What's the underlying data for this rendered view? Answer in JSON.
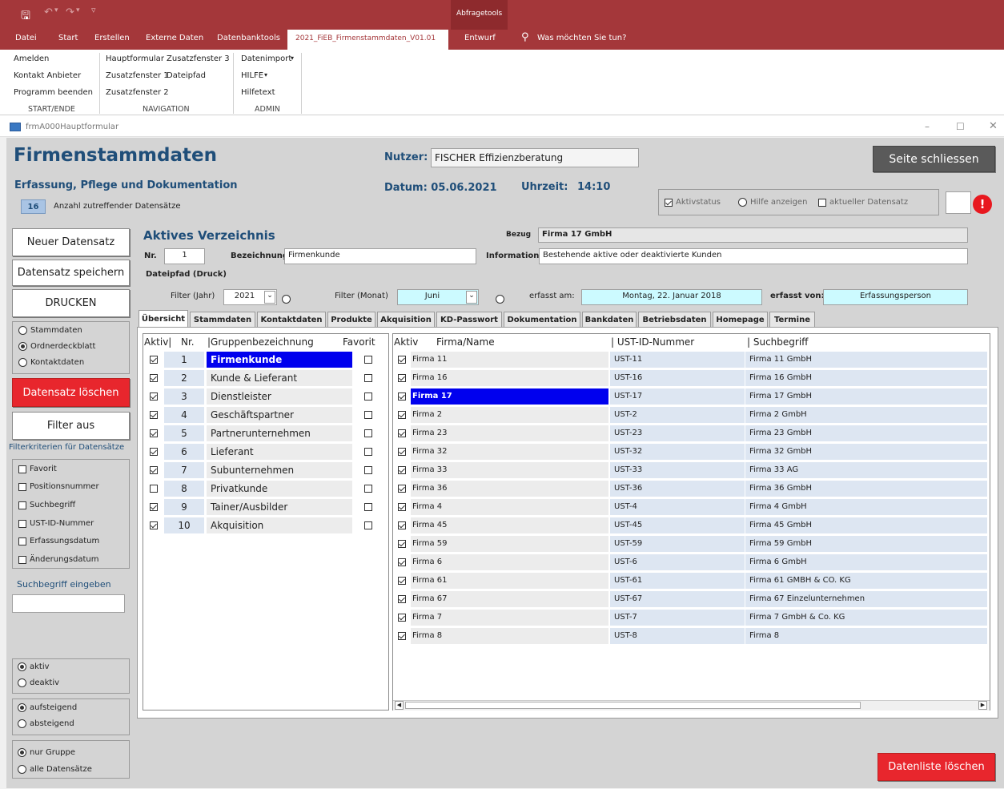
{
  "titlebar": {
    "context_group": "Abfragetools"
  },
  "menu": {
    "items": [
      "Datei",
      "Start",
      "Erstellen",
      "Externe Daten",
      "Datenbanktools",
      "2021_FiEB_Firmenstammdaten_V01.01",
      "Entwurf"
    ],
    "search": "Was möchten Sie tun?"
  },
  "ribbon": {
    "start_ende": {
      "items": [
        "Amelden",
        "Kontakt Anbieter",
        "Programm beenden"
      ],
      "label": "START/ENDE"
    },
    "navigation": {
      "items": [
        "Hauptformular",
        "Zusatzfenster 3",
        "Zusatzfenster 1",
        "Dateipfad",
        "Zusatzfenster 2"
      ],
      "label": "NAVIGATION"
    },
    "admin": {
      "items": [
        "Datenimport",
        "HILFE",
        "Hilfetext"
      ],
      "label": "ADMIN"
    }
  },
  "form": {
    "window_title": "frmA000Hauptformular",
    "title": "Firmenstammdaten",
    "subtitle": "Erfassung, Pflege und Dokumentation",
    "nutzer_label": "Nutzer:",
    "nutzer_value": "FISCHER Effizienzberatung",
    "datum": "Datum: 05.06.2021",
    "uhrzeit_label": "Uhrzeit:",
    "uhrzeit": "14:10",
    "close_button": "Seite schliessen",
    "count": "16",
    "count_label": "Anzahl zutreffender Datensätze",
    "aktivstatus": "Aktivstatus",
    "hilfe": "Hilfe anzeigen",
    "aktueller": "aktueller Datensatz",
    "warn": "!"
  },
  "left": {
    "neuer": "Neuer Datensatz",
    "speichern": "Datensatz speichern",
    "drucken": "DRUCKEN",
    "print_opts": [
      "Stammdaten",
      "Ordnerdeckblatt",
      "Kontaktdaten"
    ],
    "loeschen": "Datensatz löschen",
    "filter_aus": "Filter aus",
    "filter_title": "Filterkriterien für Datensätze",
    "filters": [
      "Favorit",
      "Positionsnummer",
      "Suchbegriff",
      "UST-ID-Nummer",
      "Erfassungsdatum",
      "Änderungsdatum"
    ],
    "search_label": "Suchbegriff eingeben",
    "status_opts": [
      "aktiv",
      "deaktiv"
    ],
    "sort_opts": [
      "aufsteigend",
      "absteigend"
    ],
    "scope_opts": [
      "nur Gruppe",
      "alle Datensätze"
    ]
  },
  "verzeichnis": {
    "title": "Aktives Verzeichnis",
    "bezug_label": "Bezug",
    "bezug": "Firma 17 GmbH",
    "nr_label": "Nr.",
    "nr": "1",
    "bezeichnung_label": "Bezeichnung",
    "bezeichnung": "Firmenkunde",
    "info_label": "Information",
    "info": "Bestehende aktive oder deaktivierte Kunden",
    "dateipfad": "Dateipfad (Druck)",
    "filter_jahr_label": "Filter (Jahr)",
    "filter_jahr": "2021",
    "filter_monat_label": "Filter (Monat)",
    "filter_monat": "Juni",
    "erfasst_am_label": "erfasst am:",
    "erfasst_am": "Montag, 22. Januar 2018",
    "erfasst_von_label": "erfasst von:",
    "erfasst_von": "Erfassungsperson"
  },
  "tabs": [
    "Übersicht",
    "Stammdaten",
    "Kontaktdaten",
    "Produkte",
    "Akquisition",
    "KD-Passwort",
    "Dokumentation",
    "Bankdaten",
    "Betriebsdaten",
    "Homepage",
    "Termine"
  ],
  "groups": {
    "headers": [
      "Aktiv|",
      "Nr.",
      "|Gruppenbezeichnung",
      "Favorit"
    ],
    "rows": [
      {
        "aktiv": true,
        "nr": "1",
        "name": "Firmenkunde",
        "fav": false
      },
      {
        "aktiv": true,
        "nr": "2",
        "name": "Kunde & Lieferant",
        "fav": false
      },
      {
        "aktiv": true,
        "nr": "3",
        "name": "Dienstleister",
        "fav": false
      },
      {
        "aktiv": true,
        "nr": "4",
        "name": "Geschäftspartner",
        "fav": false
      },
      {
        "aktiv": true,
        "nr": "5",
        "name": "Partnerunternehmen",
        "fav": false
      },
      {
        "aktiv": true,
        "nr": "6",
        "name": "Lieferant",
        "fav": false
      },
      {
        "aktiv": true,
        "nr": "7",
        "name": "Subunternehmen",
        "fav": false
      },
      {
        "aktiv": false,
        "nr": "8",
        "name": "Privatkunde",
        "fav": false
      },
      {
        "aktiv": true,
        "nr": "9",
        "name": "Tainer/Ausbilder",
        "fav": false
      },
      {
        "aktiv": true,
        "nr": "10",
        "name": "Akquisition",
        "fav": false
      }
    ]
  },
  "firms": {
    "headers": [
      "Aktiv",
      "Firma/Name",
      "| UST-ID-Nummer",
      "| Suchbegriff"
    ],
    "rows": [
      {
        "name": "Firma 11",
        "ust": "UST-11",
        "such": "Firma 11  GmbH"
      },
      {
        "name": "Firma 16",
        "ust": "UST-16",
        "such": "Firma 16 GmbH"
      },
      {
        "name": "Firma 17",
        "ust": "UST-17",
        "such": "Firma 17 GmbH"
      },
      {
        "name": "Firma 2",
        "ust": "UST-2",
        "such": "Firma 2  GmbH"
      },
      {
        "name": "Firma 23",
        "ust": "UST-23",
        "such": "Firma 23 GmbH"
      },
      {
        "name": "Firma 32",
        "ust": "UST-32",
        "such": "Firma 32 GmbH"
      },
      {
        "name": "Firma 33",
        "ust": "UST-33",
        "such": "Firma 33 AG"
      },
      {
        "name": "Firma 36",
        "ust": "UST-36",
        "such": "Firma 36 GmbH"
      },
      {
        "name": "Firma 4",
        "ust": "UST-4",
        "such": "Firma 4  GmbH"
      },
      {
        "name": "Firma 45",
        "ust": "UST-45",
        "such": "Firma 45 GmbH"
      },
      {
        "name": "Firma 59",
        "ust": "UST-59",
        "such": "Firma 59 GmbH"
      },
      {
        "name": "Firma 6",
        "ust": "UST-6",
        "such": "Firma 6 GmbH"
      },
      {
        "name": "Firma 61",
        "ust": "UST-61",
        "such": "Firma 61 GMBH & CO. KG"
      },
      {
        "name": "Firma 67",
        "ust": "UST-67",
        "such": "Firma 67 Einzelunternehmen"
      },
      {
        "name": "Firma 7",
        "ust": "UST-7",
        "such": "Firma 7  GmbH & Co. KG"
      },
      {
        "name": "Firma 8",
        "ust": "UST-8",
        "such": "Firma 8"
      }
    ]
  },
  "footer": {
    "datenliste": "Datenliste löschen"
  }
}
